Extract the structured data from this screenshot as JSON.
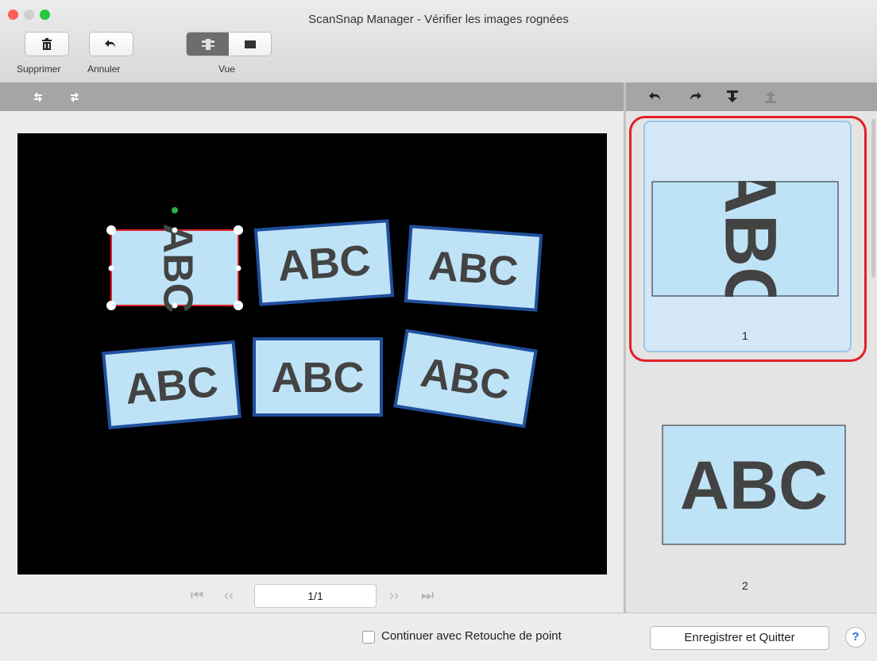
{
  "window": {
    "title": "ScanSnap Manager - Vérifier les images rognées"
  },
  "toolbar": {
    "delete_label": "Supprimer",
    "undo_label": "Annuler",
    "view_label": "Vue"
  },
  "canvas": {
    "card_text": "ABC"
  },
  "pager": {
    "value": "1/1"
  },
  "thumbnails": [
    {
      "number": "1",
      "text": "ABC"
    },
    {
      "number": "2",
      "text": "ABC"
    }
  ],
  "bottom": {
    "checkbox_label": "Continuer avec Retouche de point",
    "save_button": "Enregistrer et Quitter",
    "help": "?"
  },
  "colors": {
    "card_fill": "#bfe3f6",
    "card_border": "#1f4f9c",
    "selection": "#e21f26"
  }
}
